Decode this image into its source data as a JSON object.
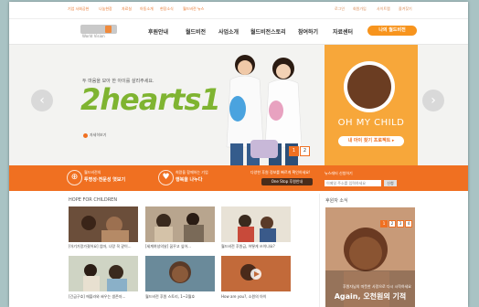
{
  "util_links": [
    "기업 사회공헌",
    "나눔현장",
    "자료실",
    "아동소개",
    "현장소식",
    "월드비전 뉴스"
  ],
  "util_right": [
    "로그인",
    "회원가입",
    "사이트맵",
    "즐겨찾기"
  ],
  "logo": {
    "text": "World Vision"
  },
  "nav": {
    "items": [
      "후원안내",
      "월드비전",
      "사업소개",
      "월드비전스토리",
      "참여하기",
      "자료센터"
    ],
    "cta": "나의 월드비전"
  },
  "hero": {
    "subtitle": "두 마음을 모아 한 아이를 살리주세요.",
    "brand": "2hearts1",
    "more": "자세히보기",
    "pages": [
      "1",
      "2"
    ]
  },
  "promo": {
    "title": "OH MY CHILD",
    "button": "내 아이 찾기 프로젝트 ▸"
  },
  "arrows": {
    "prev": "‹",
    "next": "›"
  },
  "band": {
    "c1_small": "월드비전의",
    "c1_big": "투명성·전문성 엿보기",
    "c2_small": "희망을 함께하는 기업",
    "c2_big": "행복을 나누다",
    "c3_small": "다양한 후원 정보를 빠르게 확인하세요!",
    "c3_box": "One Stop 후원안내",
    "c4_small": "뉴스레터 신청하기",
    "c4_input": "이메일 주소를 입력하세요",
    "c4_go": "신청"
  },
  "hope": {
    "title": "HOPE FOR CHILDREN",
    "items": [
      {
        "caption": "[아기가망가졌어요] 엄마, 나랑 꼭 같이..."
      },
      {
        "caption": "[세계여성의날] 꿈꾸고 싶어..."
      },
      {
        "caption": "월드비전 후원금, 어떻게 쓰이나요?"
      },
      {
        "caption": "[긴급구호] 에볼라와 싸우는 생존자..."
      },
      {
        "caption": "월드비전 후원 스토리, 1~2월호"
      },
      {
        "caption": "How are you?, 소원의 아이"
      }
    ]
  },
  "side": {
    "title": "후원자 소식",
    "line1": "후원자님의 따뜻한 사랑으로 다시 시작하세요",
    "line2": "Again, 오천원의 기적",
    "pages": [
      "1",
      "2",
      "3",
      "4"
    ]
  }
}
